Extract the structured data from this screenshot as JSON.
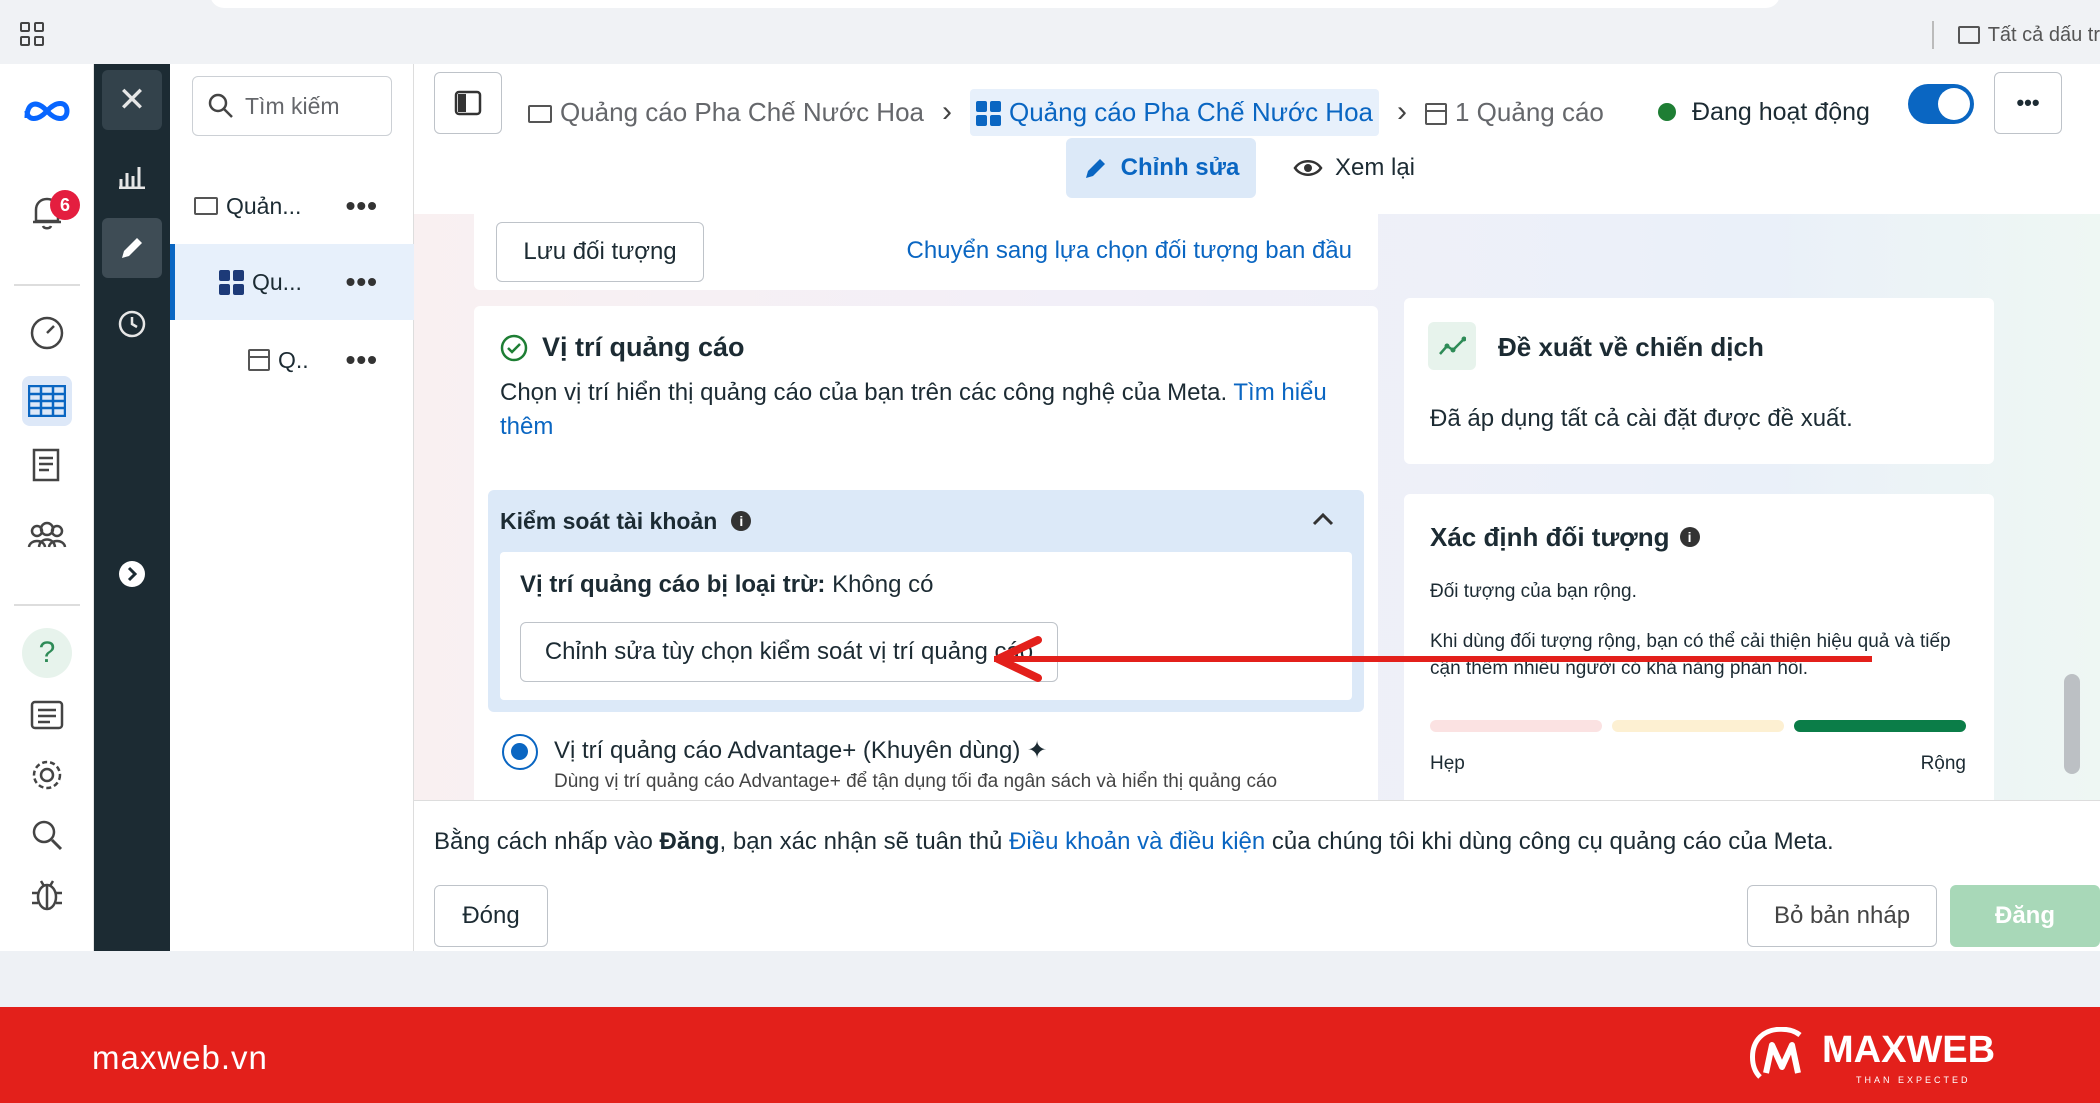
{
  "topbar": {
    "right_label": "Tất cả dấu tr"
  },
  "rail": {
    "notification_count": "6"
  },
  "tree": {
    "search_placeholder": "Tìm kiếm",
    "items": [
      {
        "label": "Quản..."
      },
      {
        "label": "Qu..."
      },
      {
        "label": "Q.."
      }
    ]
  },
  "breadcrumb": {
    "campaign": "Quảng cáo Pha Chế Nước Hoa",
    "adset": "Quảng cáo Pha Chế Nước Hoa",
    "ads": "1 Quảng cáo"
  },
  "status": {
    "label": "Đang hoạt động",
    "color": "#1e7e34"
  },
  "mode": {
    "edit": "Chỉnh sửa",
    "review": "Xem lại"
  },
  "audience_top": {
    "save_button": "Lưu đối tượng",
    "switch_link": "Chuyển sang lựa chọn đối tượng ban đầu"
  },
  "placements": {
    "title": "Vị trí quảng cáo",
    "desc": "Chọn vị trí hiển thị quảng cáo của bạn trên các công nghệ của Meta.",
    "learn_more": "Tìm hiểu thêm",
    "account_control": {
      "title": "Kiểm soát tài khoản",
      "excluded_label": "Vị trí quảng cáo bị loại trừ:",
      "excluded_value": "Không có",
      "edit_button": "Chỉnh sửa tùy chọn kiểm soát vị trí quảng cáo"
    },
    "advantage_option": "Vị trí quảng cáo Advantage+ (Khuyên dùng)",
    "advantage_desc": "Dùng vị trí quảng cáo Advantage+ để tận dụng tối đa ngân sách và hiển thị quảng cáo"
  },
  "recommend": {
    "title": "Đề xuất về chiến dịch",
    "text": "Đã áp dụng tất cả cài đặt được đề xuất."
  },
  "audience_def": {
    "title": "Xác định đối tượng",
    "subtitle": "Đối tượng của bạn rộng.",
    "desc": "Khi dùng đối tượng rộng, bạn có thể cải thiện hiệu quả và tiếp cận thêm nhiều người có khả năng phản hồi.",
    "narrow": "Hẹp",
    "broad": "Rộng",
    "level": 3,
    "levels": 3
  },
  "footer": {
    "prefix": "Bằng cách nhấp vào ",
    "bold": "Đăng",
    "middle": ", bạn xác nhận sẽ tuân thủ ",
    "link": "Điều khoản và điều kiện",
    "suffix": " của chúng tôi khi dùng công cụ quảng cáo của Meta.",
    "close": "Đóng",
    "discard": "Bỏ bản nháp",
    "publish": "Đăng"
  },
  "brand": {
    "site": "maxweb.vn",
    "name": "MAXWEB",
    "tagline": "THAN EXPECTED",
    "bar_color": "#e3201b"
  }
}
